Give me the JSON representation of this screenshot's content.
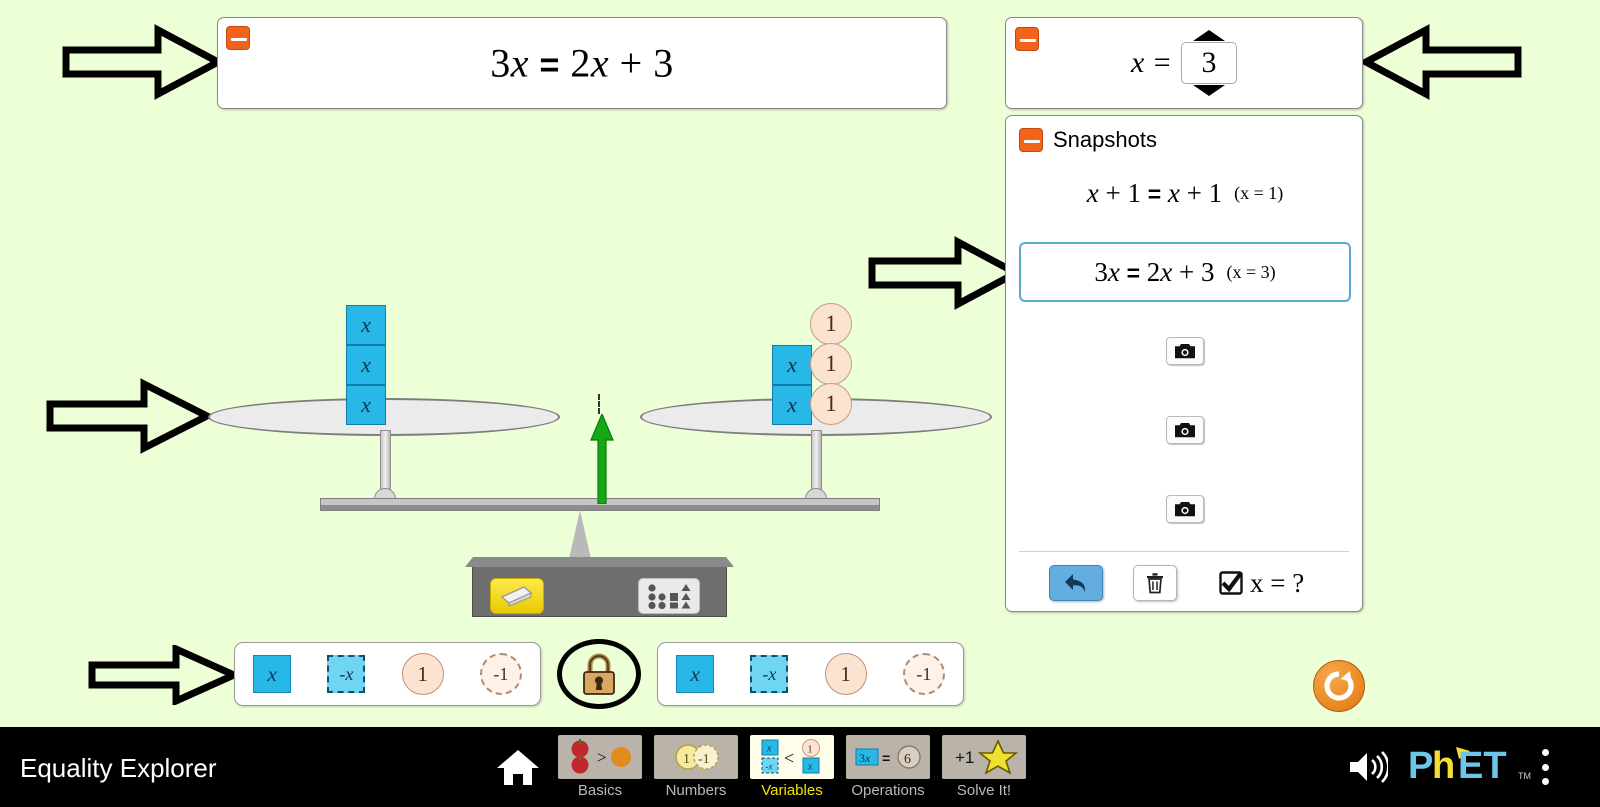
{
  "sim": {
    "title": "Equality Explorer",
    "background_color": "#EDFFD6",
    "accent_orange": "#F2631B",
    "highlight_blue": "#5AA7DD"
  },
  "equation_panel": {
    "collapse_icon": "minus-icon",
    "left_coefficient": "3",
    "left_variable": "x",
    "relation": "=",
    "right_coefficient": "2",
    "right_variable": "x",
    "right_plus": "+",
    "right_constant": "3",
    "full_text": "3x = 2x + 3"
  },
  "x_value_panel": {
    "collapse_icon": "minus-icon",
    "label": "x =",
    "value": "3",
    "up_icon": "triangle-up-icon",
    "down_icon": "triangle-down-icon"
  },
  "snapshots": {
    "collapse_icon": "minus-icon",
    "title": "Snapshots",
    "items": [
      {
        "equation": "x + 1  =  x + 1",
        "x_value": "(x = 1)",
        "selected": false,
        "empty": false,
        "left_var": "x",
        "left_plus": "+",
        "left_const": "1",
        "relation": "=",
        "right_var": "x",
        "right_plus": "+",
        "right_const": "1"
      },
      {
        "equation": "3x  =  2x + 3",
        "x_value": "(x = 3)",
        "selected": true,
        "empty": false,
        "left_coef": "3",
        "left_var": "x",
        "relation": "=",
        "right_coef": "2",
        "right_var": "x",
        "right_plus": "+",
        "right_const": "3"
      },
      {
        "equation": "",
        "x_value": "",
        "selected": false,
        "empty": true,
        "icon": "camera-icon"
      },
      {
        "equation": "",
        "x_value": "",
        "selected": false,
        "empty": true,
        "icon": "camera-icon"
      },
      {
        "equation": "",
        "x_value": "",
        "selected": false,
        "empty": true,
        "icon": "camera-icon"
      }
    ],
    "footer": {
      "restore_icon": "undo-arrow-icon",
      "trash_icon": "trash-icon",
      "checkbox_icon": "checked-checkbox-icon",
      "checkbox_checked": true,
      "checkbox_label": "x = ?"
    }
  },
  "balance_scale": {
    "state": "balanced",
    "indicator_icon": "green-up-arrow-icon",
    "left_plate": {
      "tiles": [
        {
          "type": "x",
          "label": "x"
        },
        {
          "type": "x",
          "label": "x"
        },
        {
          "type": "x",
          "label": "x"
        }
      ]
    },
    "right_plate": {
      "tiles": [
        {
          "type": "x",
          "label": "x"
        },
        {
          "type": "x",
          "label": "x"
        }
      ],
      "constants": [
        {
          "type": "one",
          "label": "1"
        },
        {
          "type": "one",
          "label": "1"
        },
        {
          "type": "one",
          "label": "1"
        }
      ]
    },
    "eraser_icon": "eraser-icon",
    "organize_icon": "organize-grid-icon"
  },
  "toolbox_left": {
    "terms": [
      {
        "label": "x",
        "shape": "square",
        "style": "solid",
        "name": "x-tile"
      },
      {
        "label": "-x",
        "shape": "square",
        "style": "dashed",
        "name": "negative-x-tile"
      },
      {
        "label": "1",
        "shape": "circle",
        "style": "solid",
        "name": "one-tile"
      },
      {
        "label": "-1",
        "shape": "circle",
        "style": "dashed",
        "name": "negative-one-tile"
      }
    ]
  },
  "toolbox_right": {
    "terms": [
      {
        "label": "x",
        "shape": "square",
        "style": "solid",
        "name": "x-tile"
      },
      {
        "label": "-x",
        "shape": "square",
        "style": "dashed",
        "name": "negative-x-tile"
      },
      {
        "label": "1",
        "shape": "circle",
        "style": "solid",
        "name": "one-tile"
      },
      {
        "label": "-1",
        "shape": "circle",
        "style": "dashed",
        "name": "negative-one-tile"
      }
    ]
  },
  "lock_control": {
    "icon": "closed-padlock-icon",
    "locked": true
  },
  "reset_button": {
    "icon": "reset-all-icon"
  },
  "navbar": {
    "title": "Equality Explorer",
    "home_icon": "home-icon",
    "tabs": [
      {
        "label": "Basics",
        "active": false
      },
      {
        "label": "Numbers",
        "active": false
      },
      {
        "label": "Variables",
        "active": true
      },
      {
        "label": "Operations",
        "active": false
      },
      {
        "label": "Solve It!",
        "active": false
      }
    ],
    "sound_icon": "sound-on-icon",
    "logo": "PhET",
    "menu_icon": "kebab-menu-icon"
  },
  "annotations": {
    "arrows": [
      {
        "direction": "right",
        "points_to": "equation-panel"
      },
      {
        "direction": "left",
        "points_to": "x-value-panel"
      },
      {
        "direction": "right",
        "points_to": "selected-snapshot"
      },
      {
        "direction": "right",
        "points_to": "left-plate"
      },
      {
        "direction": "right",
        "points_to": "left-toolbox"
      }
    ]
  }
}
